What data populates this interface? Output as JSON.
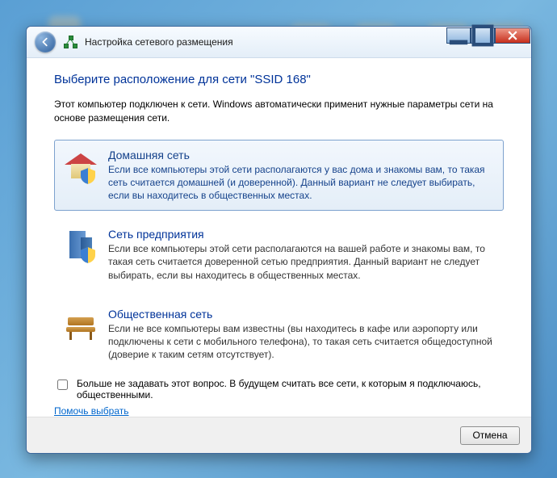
{
  "header": {
    "title": "Настройка сетевого размещения"
  },
  "page": {
    "title": "Выберите расположение для сети \"SSID  168\"",
    "intro": "Этот компьютер подключен к сети. Windows автоматически применит нужные параметры сети на основе размещения сети."
  },
  "options": {
    "home": {
      "title": "Домашняя сеть",
      "desc": "Если все компьютеры этой сети располагаются у вас дома и знакомы вам, то такая сеть считается домашней (и доверенной). Данный вариант не следует выбирать, если вы находитесь в общественных местах."
    },
    "work": {
      "title": "Сеть предприятия",
      "desc": "Если все компьютеры этой сети располагаются на вашей работе и знакомы вам, то такая сеть считается доверенной сетью предприятия. Данный вариант не следует выбирать, если вы находитесь в общественных местах."
    },
    "public": {
      "title": "Общественная сеть",
      "desc": "Если не все компьютеры вам известны (вы находитесь в кафе или аэропорту или подключены к сети с мобильного телефона), то такая сеть считается общедоступной (доверие к таким сетям отсутствует)."
    }
  },
  "checkbox_label": "Больше не задавать этот вопрос. В будущем считать все сети, к которым я подключаюсь, общественными.",
  "help_link": "Помочь выбрать",
  "footer": {
    "cancel": "Отмена"
  }
}
